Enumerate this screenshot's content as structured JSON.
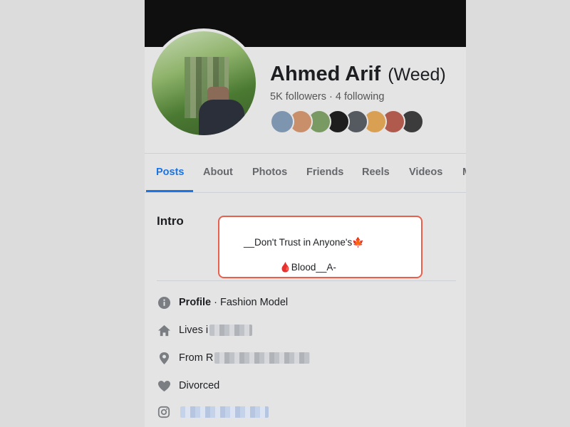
{
  "profile": {
    "name": "Ahmed Arif",
    "alternate_name": "(Weed)",
    "followers_text": "5K followers · 4 following"
  },
  "friends_avatars": [
    {
      "name": "friend-avatar-1",
      "color": "#7e95b0"
    },
    {
      "name": "friend-avatar-2",
      "color": "#c98f6b"
    },
    {
      "name": "friend-avatar-3",
      "color": "#7a9a63"
    },
    {
      "name": "friend-avatar-4",
      "color": "#1e1e1e"
    },
    {
      "name": "friend-avatar-5",
      "color": "#555a60"
    },
    {
      "name": "friend-avatar-6",
      "color": "#d9a054"
    },
    {
      "name": "friend-avatar-7",
      "color": "#b05a4e"
    },
    {
      "name": "friend-avatar-8",
      "color": "#3c3c3c"
    }
  ],
  "tabs": [
    {
      "label": "Posts",
      "active": true
    },
    {
      "label": "About"
    },
    {
      "label": "Photos"
    },
    {
      "label": "Friends"
    },
    {
      "label": "Reels"
    },
    {
      "label": "Videos"
    },
    {
      "label": "M"
    }
  ],
  "intro": {
    "title": "Intro",
    "bio_line_1": "__Don't Trust in Anyone's🍁",
    "bio_line_2": "🩸Blood__A-",
    "details": [
      {
        "icon": "info-icon",
        "strong": "Profile",
        "text": " · Fashion Model"
      },
      {
        "icon": "home-icon",
        "text": "Lives i"
      },
      {
        "icon": "location-pin-icon",
        "text": "From R"
      },
      {
        "icon": "heart-icon",
        "text": "Divorced"
      },
      {
        "icon": "instagram-icon",
        "text": ""
      }
    ]
  },
  "colors": {
    "accent": "#1b74e4",
    "highlight_border": "#e8604c"
  }
}
